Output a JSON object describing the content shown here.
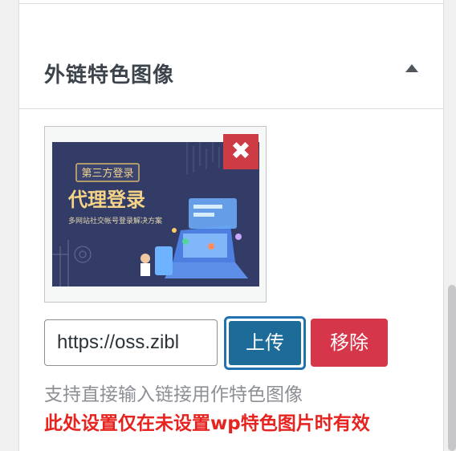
{
  "metabox": {
    "title": "外链特色图像",
    "toggle_icon": "triangle-up-icon"
  },
  "preview": {
    "close_icon": "close-icon",
    "close_glyph": "✖",
    "image": {
      "badge": "第三方登录",
      "headline": "代理登录",
      "subline": "多网站社交帐号登录解决方案"
    }
  },
  "url_field": {
    "value": "https://oss.zibl"
  },
  "buttons": {
    "upload_label": "上传",
    "remove_label": "移除"
  },
  "hint_text": "支持直接输入链接用作特色图像",
  "warning_text": "此处设置仅在未设置wp特色图片时有效",
  "colors": {
    "upload_bg": "#1d6b98",
    "upload_focus_ring": "#2271b1",
    "remove_bg": "#d63649",
    "close_bg": "#cd3b45",
    "warning": "#e6231f",
    "hint": "#8c8f94"
  }
}
